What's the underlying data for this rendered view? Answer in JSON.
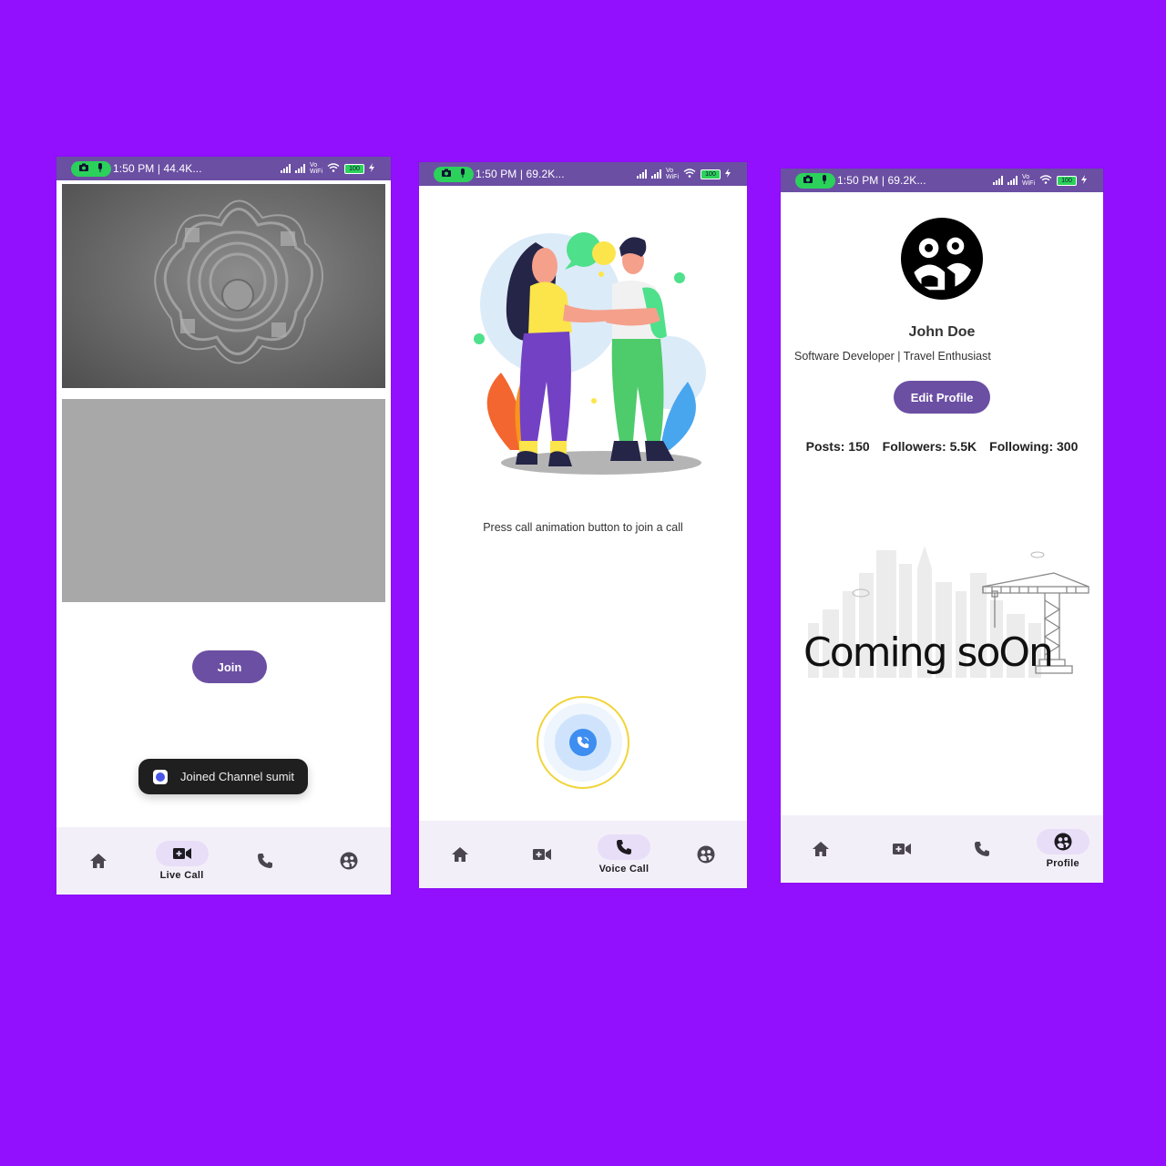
{
  "status": {
    "screen1_time": "1:50 PM | 44.4K...",
    "screen2_time": "1:50 PM | 69.2K...",
    "screen3_time": "1:50 PM | 69.2K...",
    "wifi_label": "Vo WiFi",
    "battery": "100"
  },
  "live_call_screen": {
    "join_label": "Join",
    "toast_text": "Joined Channel sumit"
  },
  "voice_call_screen": {
    "instruction": "Press call animation button to join a call"
  },
  "profile_screen": {
    "name": "John Doe",
    "bio": "Software Developer | Travel Enthusiast",
    "edit_label": "Edit Profile",
    "stats": {
      "posts": "Posts: 150",
      "followers": "Followers: 5.5K",
      "following": "Following: 300"
    },
    "coming_soon": "Coming soOn"
  },
  "nav": {
    "live_call": "Live Call",
    "voice_call": "Voice Call",
    "profile": "Profile"
  },
  "colors": {
    "background": "#9210fe",
    "accent": "#6b4fa3",
    "statusbar": "#6b4fa3",
    "nav_bg": "#f3eff8",
    "nav_active": "#e8def8"
  },
  "icons": [
    "camera-icon",
    "mic-icon",
    "home-icon",
    "video-call-icon",
    "phone-icon",
    "profile-icon"
  ]
}
